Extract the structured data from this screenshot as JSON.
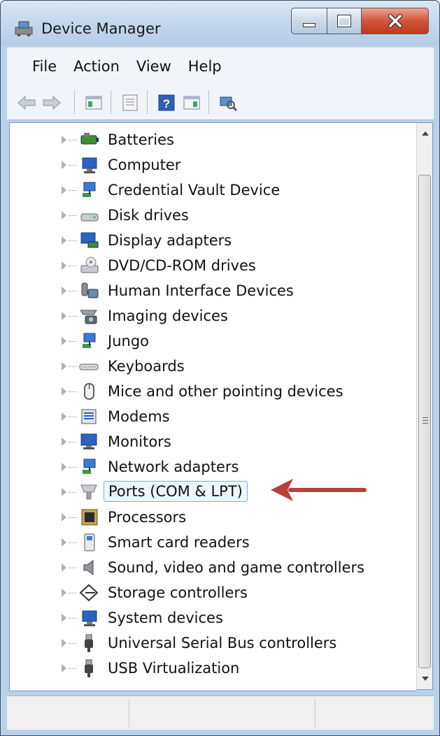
{
  "window": {
    "title": "Device Manager"
  },
  "menu": [
    "File",
    "Action",
    "View",
    "Help"
  ],
  "tree": {
    "items": [
      {
        "label": "Batteries",
        "icon": "battery-icon"
      },
      {
        "label": "Computer",
        "icon": "computer-icon"
      },
      {
        "label": "Credential Vault Device",
        "icon": "network-device-icon"
      },
      {
        "label": "Disk drives",
        "icon": "disk-drive-icon"
      },
      {
        "label": "Display adapters",
        "icon": "display-adapter-icon"
      },
      {
        "label": "DVD/CD-ROM drives",
        "icon": "dvd-drive-icon"
      },
      {
        "label": "Human Interface Devices",
        "icon": "hid-icon"
      },
      {
        "label": "Imaging devices",
        "icon": "camera-icon"
      },
      {
        "label": "Jungo",
        "icon": "network-device-icon"
      },
      {
        "label": "Keyboards",
        "icon": "keyboard-icon"
      },
      {
        "label": "Mice and other pointing devices",
        "icon": "mouse-icon"
      },
      {
        "label": "Modems",
        "icon": "modem-icon"
      },
      {
        "label": "Monitors",
        "icon": "monitor-icon"
      },
      {
        "label": "Network adapters",
        "icon": "network-adapter-icon"
      },
      {
        "label": "Ports (COM & LPT)",
        "icon": "port-icon",
        "selected": true
      },
      {
        "label": "Processors",
        "icon": "processor-icon"
      },
      {
        "label": "Smart card readers",
        "icon": "smart-card-icon"
      },
      {
        "label": "Sound, video and game controllers",
        "icon": "speaker-icon"
      },
      {
        "label": "Storage controllers",
        "icon": "storage-icon"
      },
      {
        "label": "System devices",
        "icon": "computer-icon"
      },
      {
        "label": "Universal Serial Bus controllers",
        "icon": "usb-icon"
      },
      {
        "label": "USB Virtualization",
        "icon": "usb-icon"
      }
    ]
  },
  "colors": {
    "annotation_arrow": "#b6403a",
    "selection_border": "#84acdd",
    "close_button": "#c8452a"
  }
}
